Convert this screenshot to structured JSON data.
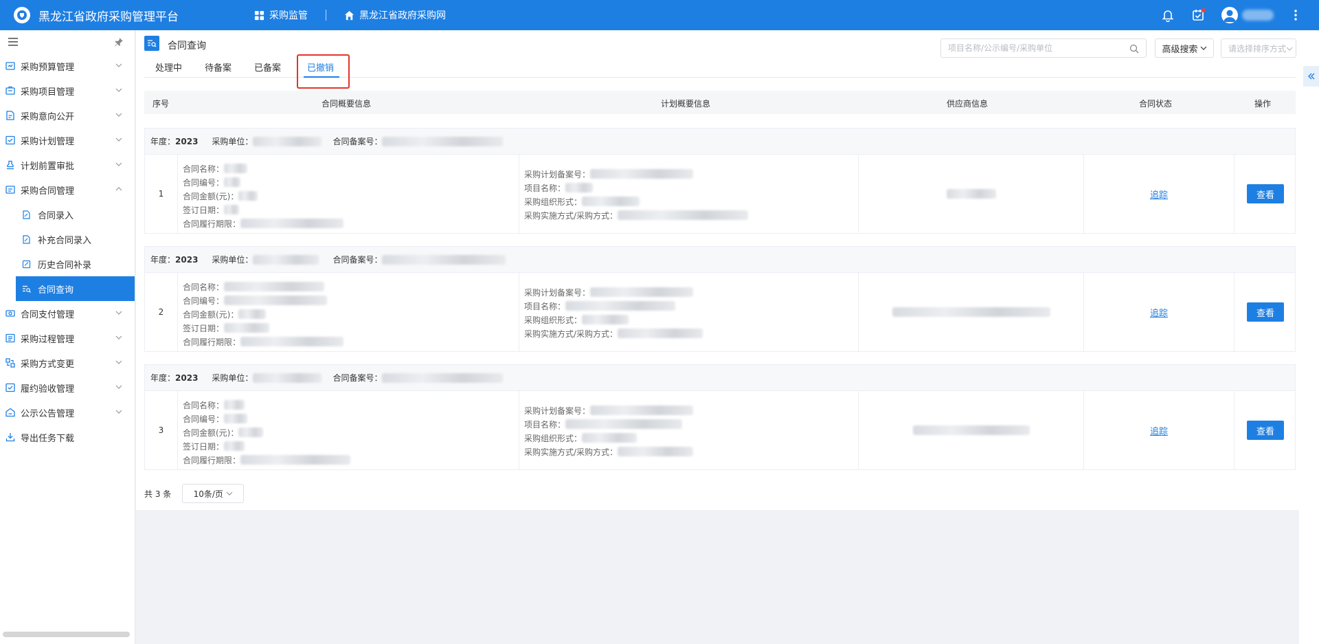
{
  "header": {
    "app_title": "黑龙江省政府采购管理平台",
    "nav": [
      {
        "label": "采购监管",
        "icon": "grid-icon"
      },
      {
        "label": "黑龙江省政府采购网",
        "icon": "home-icon"
      }
    ],
    "right_icons": [
      "bell-icon",
      "task-icon",
      "avatar-icon",
      "more-icon"
    ]
  },
  "sidebar": {
    "items": [
      {
        "label": "采购预算管理",
        "icon": "budget-icon"
      },
      {
        "label": "采购项目管理",
        "icon": "project-icon"
      },
      {
        "label": "采购意向公开",
        "icon": "intent-icon"
      },
      {
        "label": "采购计划管理",
        "icon": "plan-icon"
      },
      {
        "label": "计划前置审批",
        "icon": "approve-icon"
      },
      {
        "label": "采购合同管理",
        "icon": "contract-icon",
        "expanded": true
      },
      {
        "label": "合同支付管理",
        "icon": "payment-icon"
      },
      {
        "label": "采购过程管理",
        "icon": "process-icon"
      },
      {
        "label": "采购方式变更",
        "icon": "change-icon"
      },
      {
        "label": "履约验收管理",
        "icon": "accept-icon"
      },
      {
        "label": "公示公告管理",
        "icon": "notice-icon"
      },
      {
        "label": "导出任务下载",
        "icon": "download-icon"
      }
    ],
    "sub_items": [
      {
        "label": "合同录入"
      },
      {
        "label": "补充合同录入"
      },
      {
        "label": "历史合同补录"
      },
      {
        "label": "合同查询",
        "active": true
      }
    ]
  },
  "page": {
    "title": "合同查询",
    "tabs": [
      {
        "label": "处理中"
      },
      {
        "label": "待备案"
      },
      {
        "label": "已备案"
      },
      {
        "label": "已撤销",
        "active": true
      }
    ],
    "search_placeholder": "项目名称/公示编号/采购单位",
    "advanced_search": "高级搜索",
    "sort_placeholder": "请选择排序方式"
  },
  "table": {
    "columns": [
      "序号",
      "合同概要信息",
      "计划概要信息",
      "供应商信息",
      "合同状态",
      "操作"
    ],
    "group_labels": {
      "year": "年度：",
      "unit": "采购单位：",
      "record_no": "合同备案号："
    },
    "contract_fields": [
      "合同名称：",
      "合同编号：",
      "合同金额(元)：",
      "签订日期：",
      "合同履行期限："
    ],
    "plan_fields": [
      "采购计划备案号：",
      "项目名称：",
      "采购组织形式：",
      "采购实施方式/采购方式："
    ],
    "rows": [
      {
        "index": "1",
        "year": "2023",
        "status_link": "追踪",
        "action": "查看"
      },
      {
        "index": "2",
        "year": "2023",
        "status_link": "追踪",
        "action": "查看"
      },
      {
        "index": "3",
        "year": "2023",
        "status_link": "追踪",
        "action": "查看"
      }
    ]
  },
  "pager": {
    "total": "共 3 条",
    "page_size": "10条/页"
  },
  "colors": {
    "primary": "#1e7fe3",
    "highlight": "#e5332a"
  }
}
